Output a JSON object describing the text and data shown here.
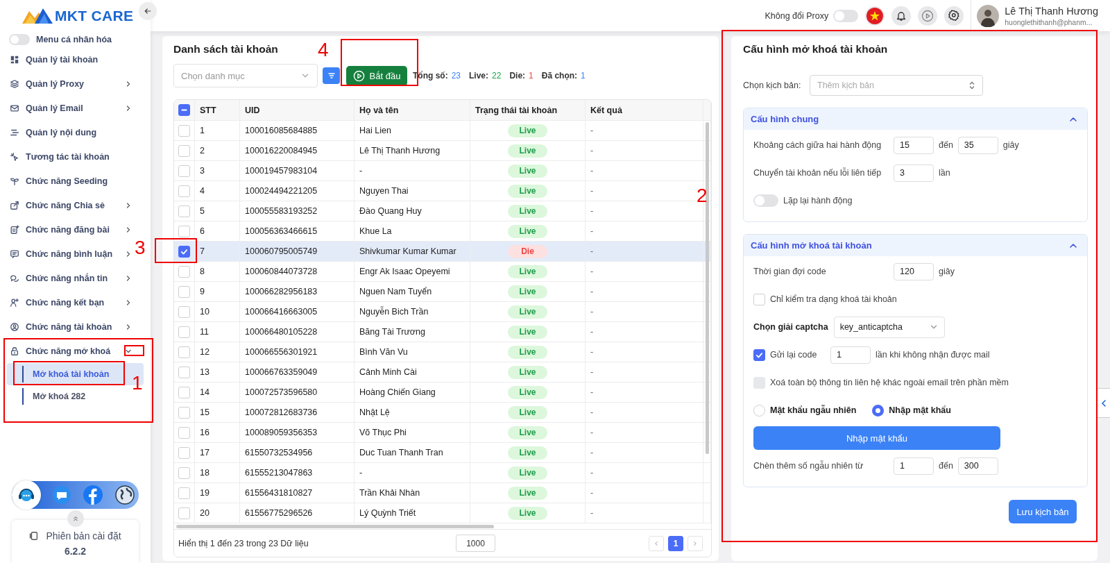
{
  "app": {
    "logo_text": "MKT CARE"
  },
  "sidebar": {
    "personalize_toggle": {
      "label": "Menu cá nhân hóa",
      "on": false
    },
    "items": [
      {
        "label": "Quản lý tài khoản",
        "kind": "link"
      },
      {
        "label": "Quản lý Proxy",
        "kind": "group",
        "expanded": false
      },
      {
        "label": "Quản lý Email",
        "kind": "group",
        "expanded": false
      },
      {
        "label": "Quản lý nội dung",
        "kind": "link"
      },
      {
        "label": "Tương tác tài khoản",
        "kind": "link"
      },
      {
        "label": "Chức năng Seeding",
        "kind": "link"
      },
      {
        "label": "Chức năng Chia sẻ",
        "kind": "group",
        "expanded": false
      },
      {
        "label": "Chức năng đăng bài",
        "kind": "group",
        "expanded": false
      },
      {
        "label": "Chức năng bình luận",
        "kind": "group",
        "expanded": false
      },
      {
        "label": "Chức năng nhắn tin",
        "kind": "group",
        "expanded": false
      },
      {
        "label": "Chức năng kết bạn",
        "kind": "group",
        "expanded": false
      },
      {
        "label": "Chức năng tài khoản",
        "kind": "group",
        "expanded": false
      },
      {
        "label": "Chức năng mở khoá",
        "kind": "group",
        "expanded": true,
        "children": [
          {
            "label": "Mở khoá tài khoản",
            "selected": true
          },
          {
            "label": "Mở khoá 282",
            "selected": false
          }
        ]
      }
    ],
    "version": {
      "label": "Phiên bản cài đặt",
      "value": "6.2.2"
    }
  },
  "topbar": {
    "proxy_toggle": {
      "label": "Không đổi Proxy",
      "on": false
    },
    "user": {
      "name": "Lê Thị Thanh Hương",
      "email": "huonglethithanh@phanm..."
    }
  },
  "account_list": {
    "title": "Danh sách tài khoản",
    "category_select": {
      "placeholder": "Chọn danh mục"
    },
    "start_button": "Bắt đầu",
    "stats": [
      {
        "label": "Tổng số:",
        "value": "23",
        "color": "#3b82f6"
      },
      {
        "label": "Live:",
        "value": "22",
        "color": "#16a34a"
      },
      {
        "label": "Die:",
        "value": "1",
        "color": "#ef4444"
      },
      {
        "label": "Đã chọn:",
        "value": "1",
        "color": "#3b82f6"
      }
    ],
    "table": {
      "header_checkbox": {
        "indeterminate": true
      },
      "columns": [
        "STT",
        "UID",
        "Họ và tên",
        "Trạng thái tài khoản",
        "Kết quả"
      ],
      "rows": [
        {
          "stt": "1",
          "uid": "100016085684885",
          "name": "Hai Lien",
          "status": {
            "text": "Live",
            "kind": "live"
          },
          "result": "-",
          "selected": false
        },
        {
          "stt": "2",
          "uid": "100016220084945",
          "name": "Lê Thị Thanh Hương",
          "status": {
            "text": "Live",
            "kind": "live"
          },
          "result": "-",
          "selected": false
        },
        {
          "stt": "3",
          "uid": "100019457983104",
          "name": "-",
          "status": {
            "text": "Live",
            "kind": "live"
          },
          "result": "-",
          "selected": false
        },
        {
          "stt": "4",
          "uid": "100024494221205",
          "name": "Nguyen Thai",
          "status": {
            "text": "Live",
            "kind": "live"
          },
          "result": "-",
          "selected": false
        },
        {
          "stt": "5",
          "uid": "100055583193252",
          "name": "Đào Quang Huy",
          "status": {
            "text": "Live",
            "kind": "live"
          },
          "result": "-",
          "selected": false
        },
        {
          "stt": "6",
          "uid": "100056363466615",
          "name": "Khue La",
          "status": {
            "text": "Live",
            "kind": "live"
          },
          "result": "-",
          "selected": false
        },
        {
          "stt": "7",
          "uid": "100060795005749",
          "name": "Shivkumar Kumar Kumar",
          "status": {
            "text": "Die",
            "kind": "die"
          },
          "result": "-",
          "selected": true
        },
        {
          "stt": "8",
          "uid": "100060844073728",
          "name": "Engr Ak Isaac Opeyemi",
          "status": {
            "text": "Live",
            "kind": "live"
          },
          "result": "-",
          "selected": false
        },
        {
          "stt": "9",
          "uid": "100066282956183",
          "name": "Nguen Nam Tuyển",
          "status": {
            "text": "Live",
            "kind": "live"
          },
          "result": "-",
          "selected": false
        },
        {
          "stt": "10",
          "uid": "100066416663005",
          "name": "Nguyễn Bich Trần",
          "status": {
            "text": "Live",
            "kind": "live"
          },
          "result": "-",
          "selected": false
        },
        {
          "stt": "11",
          "uid": "100066480105228",
          "name": "Băng Tài Trương",
          "status": {
            "text": "Live",
            "kind": "live"
          },
          "result": "-",
          "selected": false
        },
        {
          "stt": "12",
          "uid": "100066556301921",
          "name": "Bình Văn Vu",
          "status": {
            "text": "Live",
            "kind": "live"
          },
          "result": "-",
          "selected": false
        },
        {
          "stt": "13",
          "uid": "100066763359049",
          "name": "Cảnh Minh Cài",
          "status": {
            "text": "Live",
            "kind": "live"
          },
          "result": "-",
          "selected": false
        },
        {
          "stt": "14",
          "uid": "100072573596580",
          "name": "Hoàng Chiến Giang",
          "status": {
            "text": "Live",
            "kind": "live"
          },
          "result": "-",
          "selected": false
        },
        {
          "stt": "15",
          "uid": "100072812683736",
          "name": "Nhật Lệ",
          "status": {
            "text": "Live",
            "kind": "live"
          },
          "result": "-",
          "selected": false
        },
        {
          "stt": "16",
          "uid": "100089059356353",
          "name": "Võ Thục Phi",
          "status": {
            "text": "Live",
            "kind": "live"
          },
          "result": "-",
          "selected": false
        },
        {
          "stt": "17",
          "uid": "61550732534956",
          "name": "Duc Tuan Thanh Tran",
          "status": {
            "text": "Live",
            "kind": "live"
          },
          "result": "-",
          "selected": false
        },
        {
          "stt": "18",
          "uid": "61555213047863",
          "name": "-",
          "status": {
            "text": "Live",
            "kind": "live"
          },
          "result": "-",
          "selected": false
        },
        {
          "stt": "19",
          "uid": "61556431810827",
          "name": "Trần Khải Nhàn",
          "status": {
            "text": "Live",
            "kind": "live"
          },
          "result": "-",
          "selected": false
        },
        {
          "stt": "20",
          "uid": "61556775296526",
          "name": "Lý Quỳnh Triết",
          "status": {
            "text": "Live",
            "kind": "live"
          },
          "result": "-",
          "selected": false
        }
      ]
    },
    "footer": {
      "summary": "Hiển thị 1 đến 23 trong 23 Dữ liệu",
      "page_size": "1000",
      "pages": [
        {
          "label": "1",
          "selected": true
        }
      ]
    }
  },
  "config": {
    "title": "Cấu hình mở khoá tài khoản",
    "script_select": {
      "label": "Chọn kịch bản:",
      "placeholder": "Thêm kịch bản"
    },
    "sections": [
      {
        "title": "Cấu hình chung",
        "expanded": true,
        "rows": [
          {
            "kind": "range",
            "label": "Khoảng cách giữa hai hành động",
            "from": "15",
            "to_label": "đến",
            "to": "35",
            "unit": "giây"
          },
          {
            "kind": "number",
            "label": "Chuyển tài khoản nếu lỗi liên tiếp",
            "value": "3",
            "unit": "lần"
          },
          {
            "kind": "toggle",
            "label": "Lặp lại hành động",
            "on": false
          }
        ]
      },
      {
        "title": "Cấu hình mở khoá tài khoản",
        "expanded": true,
        "rows": [
          {
            "kind": "number",
            "label": "Thời gian đợi code",
            "value": "120",
            "unit": "giây"
          },
          {
            "kind": "checkbox",
            "label": "Chỉ kiểm tra dạng khoá tài khoản",
            "checked": false,
            "disabled": false
          },
          {
            "kind": "select",
            "label": "Chọn giải captcha",
            "value": "key_anticaptcha"
          },
          {
            "kind": "checkbox_number",
            "label": "Gửi lại code",
            "checked": true,
            "value": "1",
            "unit": "lần khi không nhận được mail"
          },
          {
            "kind": "checkbox",
            "label": "Xoá toàn bộ thông tin liên hệ khác ngoài email trên phần mềm",
            "checked": false,
            "disabled": true
          },
          {
            "kind": "radios",
            "options": [
              {
                "label": "Mật khẩu ngẫu nhiên",
                "selected": false
              },
              {
                "label": "Nhập mật khẩu",
                "selected": true
              }
            ]
          },
          {
            "kind": "button",
            "label": "Nhập mật khẩu"
          },
          {
            "kind": "range",
            "label": "Chèn thêm số ngẫu nhiên từ",
            "from": "1",
            "to_label": "đến",
            "to": "300",
            "unit": ""
          }
        ]
      }
    ],
    "save_button": "Lưu kịch bản"
  },
  "annotations": [
    {
      "label": "1"
    },
    {
      "label": "2"
    },
    {
      "label": "3"
    },
    {
      "label": "4"
    }
  ]
}
